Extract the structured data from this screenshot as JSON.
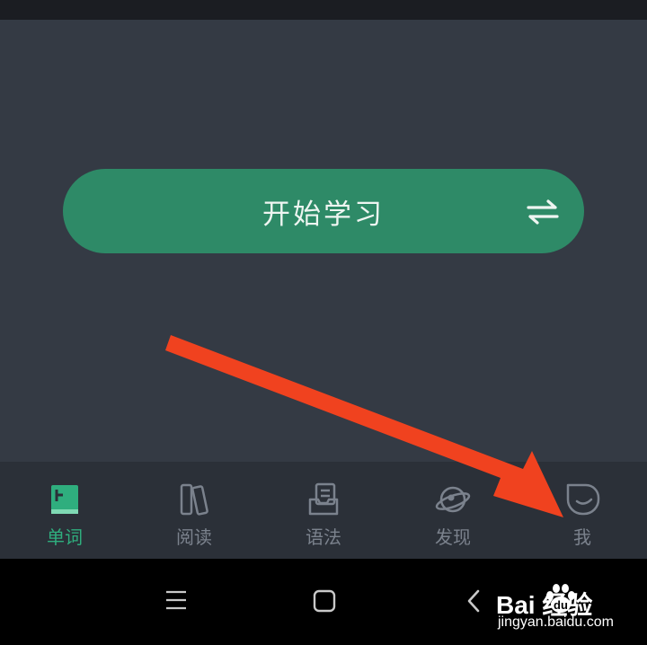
{
  "main": {
    "start_button_label": "开始学习"
  },
  "tabs": [
    {
      "label": "单词",
      "icon": "book-icon",
      "active": true
    },
    {
      "label": "阅读",
      "icon": "books-icon",
      "active": false
    },
    {
      "label": "语法",
      "icon": "document-stack-icon",
      "active": false
    },
    {
      "label": "发现",
      "icon": "planet-icon",
      "active": false
    },
    {
      "label": "我",
      "icon": "profile-icon",
      "active": false
    }
  ],
  "system_nav": {
    "icons": [
      "menu-icon",
      "home-icon",
      "back-icon"
    ]
  },
  "watermark": {
    "brand": "Bai  经验",
    "url": "jingyan.baidu.com"
  },
  "colors": {
    "accent": "#2e8a67",
    "active_tab": "#2fae7e",
    "inactive_tab": "#7b828d",
    "annotation_arrow": "#f0421f"
  }
}
